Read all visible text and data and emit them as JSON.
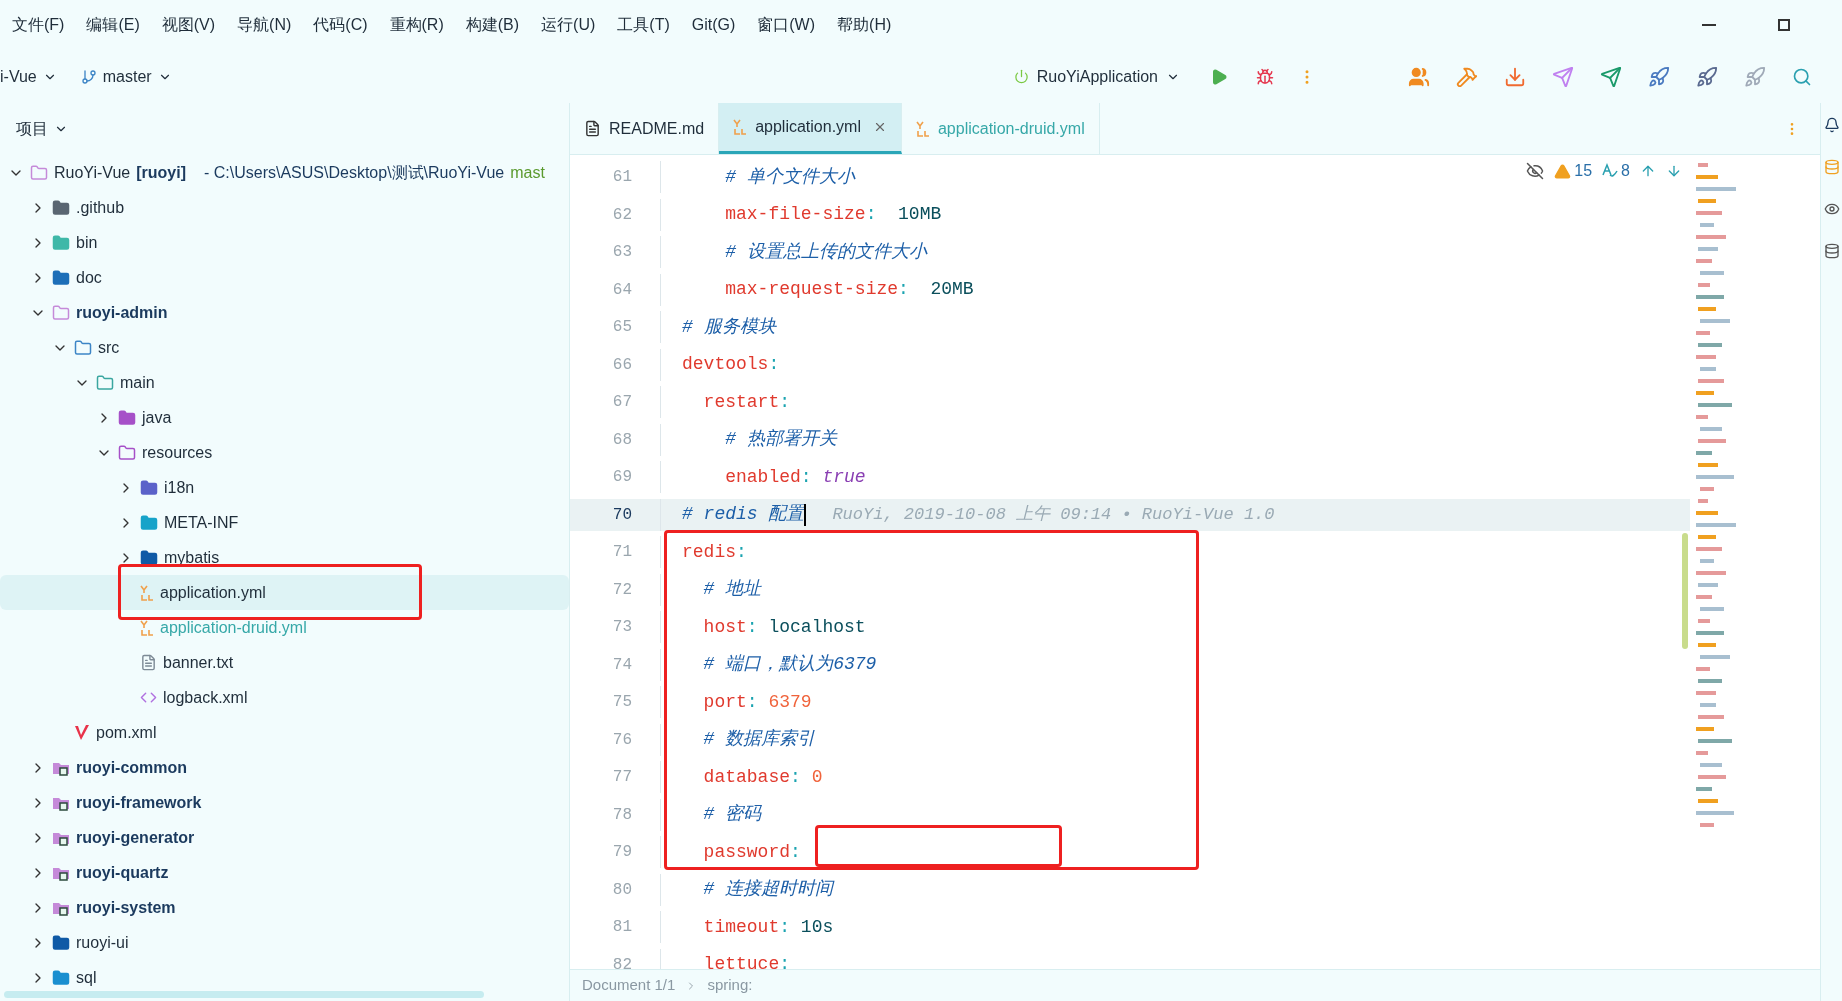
{
  "menu": [
    "文件(F)",
    "编辑(E)",
    "视图(V)",
    "导航(N)",
    "代码(C)",
    "重构(R)",
    "构建(B)",
    "运行(U)",
    "工具(T)",
    "Git(G)",
    "窗口(W)",
    "帮助(H)"
  ],
  "toolbar": {
    "project": "i-Vue",
    "branch": "master",
    "run_config": "RuoYiApplication"
  },
  "project_panel": {
    "title": "项目",
    "tree": [
      {
        "name": "RuoYi-Vue",
        "module": "[ruoyi]",
        "path": "- C:\\Users\\ASUS\\Desktop\\测试\\RuoYi-Vue",
        "branch": "mast",
        "kind": "folder",
        "expanded": true,
        "selected": false,
        "children": [
          {
            "name": ".github",
            "kind": "folder-git",
            "expanded": false,
            "selected": false
          },
          {
            "name": "bin",
            "kind": "folder-bin",
            "expanded": false,
            "selected": false
          },
          {
            "name": "doc",
            "kind": "folder-doc",
            "expanded": false,
            "selected": false
          },
          {
            "name": "ruoyi-admin",
            "kind": "folder",
            "bold": true,
            "expanded": true,
            "selected": false,
            "children": [
              {
                "name": "src",
                "kind": "folder-src",
                "expanded": true,
                "selected": false,
                "children": [
                  {
                    "name": "main",
                    "kind": "folder-main",
                    "expanded": true,
                    "selected": false,
                    "children": [
                      {
                        "name": "java",
                        "kind": "folder-java",
                        "expanded": false,
                        "selected": false
                      },
                      {
                        "name": "resources",
                        "kind": "folder-res",
                        "expanded": true,
                        "selected": false,
                        "children": [
                          {
                            "name": "i18n",
                            "kind": "folder-i18n",
                            "expanded": false,
                            "selected": false
                          },
                          {
                            "name": "META-INF",
                            "kind": "folder-meta",
                            "expanded": false,
                            "selected": false
                          },
                          {
                            "name": "mybatis",
                            "kind": "folder-plain",
                            "expanded": false,
                            "selected": false
                          },
                          {
                            "name": "application.yml",
                            "kind": "yaml",
                            "selected": true
                          },
                          {
                            "name": "application-druid.yml",
                            "kind": "yaml",
                            "added": true,
                            "selected": false
                          },
                          {
                            "name": "banner.txt",
                            "kind": "text",
                            "selected": false
                          },
                          {
                            "name": "logback.xml",
                            "kind": "xml",
                            "selected": false
                          }
                        ]
                      }
                    ]
                  }
                ]
              },
              {
                "name": "pom.xml",
                "kind": "maven",
                "selected": false
              }
            ]
          },
          {
            "name": "ruoyi-common",
            "kind": "module",
            "bold": true,
            "expanded": false,
            "selected": false
          },
          {
            "name": "ruoyi-framework",
            "kind": "module",
            "bold": true,
            "expanded": false,
            "selected": false
          },
          {
            "name": "ruoyi-generator",
            "kind": "module",
            "bold": true,
            "expanded": false,
            "selected": false
          },
          {
            "name": "ruoyi-quartz",
            "kind": "module",
            "bold": true,
            "expanded": false,
            "selected": false
          },
          {
            "name": "ruoyi-system",
            "kind": "module",
            "bold": true,
            "expanded": false,
            "selected": false
          },
          {
            "name": "ruoyi-ui",
            "kind": "folder-plain",
            "expanded": false,
            "selected": false
          },
          {
            "name": "sql",
            "kind": "folder-sql",
            "expanded": false,
            "selected": false
          }
        ]
      }
    ]
  },
  "tabs": [
    {
      "label": "README.md",
      "kind": "markdown",
      "selected": false,
      "added": false
    },
    {
      "label": "application.yml",
      "kind": "yaml",
      "selected": true,
      "added": false
    },
    {
      "label": "application-druid.yml",
      "kind": "yaml",
      "selected": false,
      "added": true
    }
  ],
  "inspections": {
    "warnings": "15",
    "typos": "8"
  },
  "code": [
    {
      "number": "61",
      "current": false,
      "tokens": [
        {
          "kind": "comment",
          "text": "    # 单个文件大小"
        }
      ]
    },
    {
      "number": "62",
      "current": false,
      "tokens": [
        {
          "kind": "key",
          "text": "    max-file-size"
        },
        {
          "kind": "colon",
          "text": ":  "
        },
        {
          "kind": "string",
          "text": "10MB"
        }
      ]
    },
    {
      "number": "63",
      "current": false,
      "tokens": [
        {
          "kind": "comment",
          "text": "    # 设置总上传的文件大小"
        }
      ]
    },
    {
      "number": "64",
      "current": false,
      "tokens": [
        {
          "kind": "key",
          "text": "    max-request-size"
        },
        {
          "kind": "colon",
          "text": ":  "
        },
        {
          "kind": "string",
          "text": "20MB"
        }
      ]
    },
    {
      "number": "65",
      "current": false,
      "tokens": [
        {
          "kind": "comment",
          "text": "# 服务模块"
        }
      ]
    },
    {
      "number": "66",
      "current": false,
      "tokens": [
        {
          "kind": "key",
          "text": "devtools"
        },
        {
          "kind": "colon",
          "text": ":"
        }
      ]
    },
    {
      "number": "67",
      "current": false,
      "tokens": [
        {
          "kind": "key",
          "text": "  restart"
        },
        {
          "kind": "colon",
          "text": ":"
        }
      ]
    },
    {
      "number": "68",
      "current": false,
      "tokens": [
        {
          "kind": "comment",
          "text": "    # 热部署开关"
        }
      ]
    },
    {
      "number": "69",
      "current": false,
      "tokens": [
        {
          "kind": "key",
          "text": "    enabled"
        },
        {
          "kind": "colon",
          "text": ": "
        },
        {
          "kind": "keyword",
          "text": "true"
        }
      ]
    },
    {
      "number": "70",
      "current": true,
      "tokens": [
        {
          "kind": "comment",
          "text": "# redis 配置"
        }
      ],
      "blame": "RuoYi, 2019-10-08 上午 09:14 • RuoYi-Vue 1.0"
    },
    {
      "number": "71",
      "current": false,
      "tokens": [
        {
          "kind": "key",
          "text": "redis"
        },
        {
          "kind": "colon",
          "text": ":"
        }
      ]
    },
    {
      "number": "72",
      "current": false,
      "tokens": [
        {
          "kind": "comment",
          "text": "  # 地址"
        }
      ]
    },
    {
      "number": "73",
      "current": false,
      "tokens": [
        {
          "kind": "key",
          "text": "  host"
        },
        {
          "kind": "colon",
          "text": ": "
        },
        {
          "kind": "string",
          "text": "localhost"
        }
      ]
    },
    {
      "number": "74",
      "current": false,
      "tokens": [
        {
          "kind": "comment",
          "text": "  # 端口，默认为6379"
        }
      ]
    },
    {
      "number": "75",
      "current": false,
      "tokens": [
        {
          "kind": "key",
          "text": "  port"
        },
        {
          "kind": "colon",
          "text": ": "
        },
        {
          "kind": "number",
          "text": "6379"
        }
      ]
    },
    {
      "number": "76",
      "current": false,
      "tokens": [
        {
          "kind": "comment",
          "text": "  # 数据库索引"
        }
      ]
    },
    {
      "number": "77",
      "current": false,
      "tokens": [
        {
          "kind": "key",
          "text": "  database"
        },
        {
          "kind": "colon",
          "text": ": "
        },
        {
          "kind": "number",
          "text": "0"
        }
      ]
    },
    {
      "number": "78",
      "current": false,
      "tokens": [
        {
          "kind": "comment",
          "text": "  # 密码"
        }
      ]
    },
    {
      "number": "79",
      "current": false,
      "tokens": [
        {
          "kind": "key",
          "text": "  password"
        },
        {
          "kind": "colon",
          "text": ":"
        }
      ]
    },
    {
      "number": "80",
      "current": false,
      "tokens": [
        {
          "kind": "comment",
          "text": "  # 连接超时时间"
        }
      ]
    },
    {
      "number": "81",
      "current": false,
      "tokens": [
        {
          "kind": "key",
          "text": "  timeout"
        },
        {
          "kind": "colon",
          "text": ": "
        },
        {
          "kind": "string",
          "text": "10s"
        }
      ]
    },
    {
      "number": "82",
      "current": false,
      "tokens": [
        {
          "kind": "key",
          "text": "  lettuce"
        },
        {
          "kind": "colon",
          "text": ":"
        }
      ]
    }
  ],
  "status_bar": {
    "breadcrumbs": [
      "Document 1/1",
      "spring:"
    ]
  }
}
